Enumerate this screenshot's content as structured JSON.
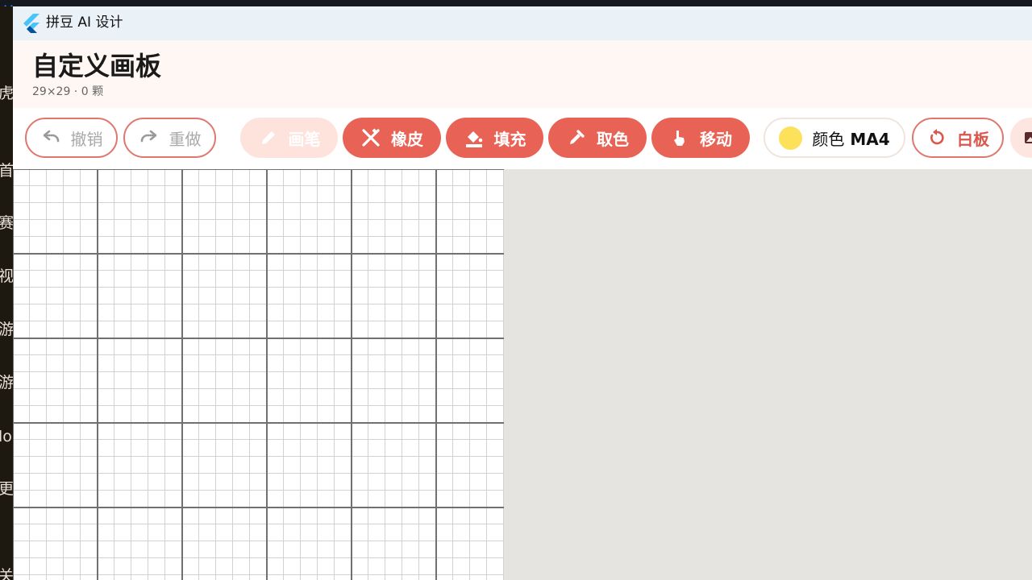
{
  "background": {
    "sidebar_items": [
      "虎",
      "首",
      "赛",
      "视",
      "游",
      "游",
      "lo",
      "更",
      "关"
    ]
  },
  "window": {
    "title": "拼豆 AI 设计"
  },
  "header": {
    "title": "自定义画板",
    "subtitle": "29×29 · 0 颗"
  },
  "toolbar": {
    "undo_label": "撤销",
    "redo_label": "重做",
    "brush_label": "画笔",
    "eraser_label": "橡皮",
    "fill_label": "填充",
    "picker_label": "取色",
    "move_label": "移动",
    "color_prefix": "颜色",
    "color_code": "MA4",
    "color_swatch": "#fde15b",
    "whiteboard_label": "白板"
  },
  "canvas": {
    "grid_size": "29×29",
    "bead_count": 0
  },
  "colors": {
    "accent": "#e86256",
    "accent_pale": "#fde3dc",
    "header_bg": "#fff7f3",
    "titlebar_bg": "#eaf1f7"
  },
  "icons": [
    "flutter-logo-icon",
    "undo-icon",
    "redo-icon",
    "pencil-icon",
    "eraser-icon",
    "fill-bucket-icon",
    "eyedropper-icon",
    "hand-pointer-icon",
    "reset-icon",
    "image-icon"
  ]
}
